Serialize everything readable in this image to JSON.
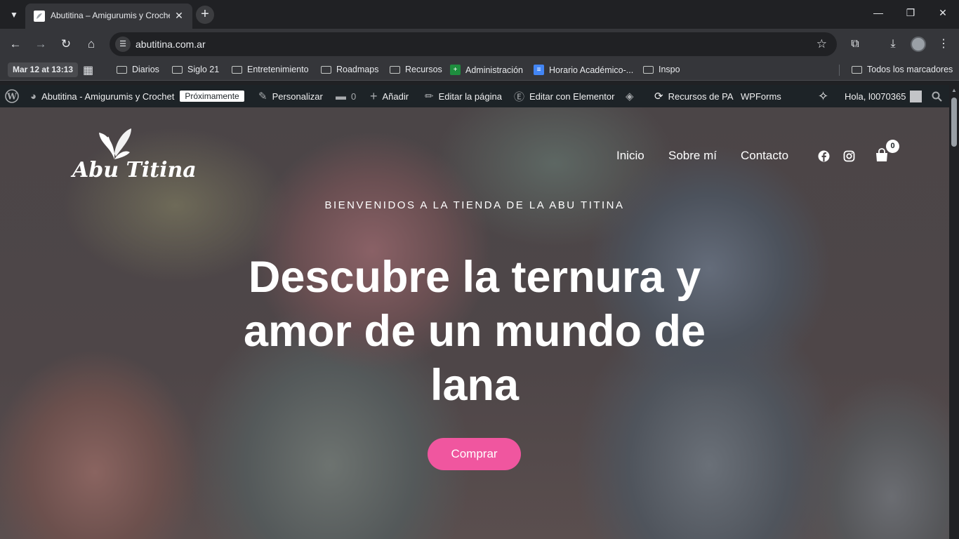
{
  "browser": {
    "tab": {
      "title": "Abutitina – Amigurumis y Crochet"
    },
    "address": {
      "url": "abutitina.com.ar"
    },
    "bookmarks": {
      "date_chip": "Mar 12 at 13:13",
      "items": [
        {
          "label": "Diarios",
          "type": "folder"
        },
        {
          "label": "Siglo 21",
          "type": "folder"
        },
        {
          "label": "Entretenimiento",
          "type": "folder"
        },
        {
          "label": "Roadmaps",
          "type": "folder"
        },
        {
          "label": "Recursos",
          "type": "folder"
        },
        {
          "label": "Administración",
          "type": "sheets"
        },
        {
          "label": "Horario Académico-...",
          "type": "docs"
        },
        {
          "label": "Inspo",
          "type": "folder"
        }
      ],
      "all_bookmarks": "Todos los marcadores"
    }
  },
  "adminbar": {
    "site_name": "Abutitina - Amigurumis y Crochet",
    "badge": "Próximamente",
    "customize": "Personalizar",
    "comments_count": "0",
    "add_new": "Añadir",
    "edit_page": "Editar la página",
    "edit_elementor": "Editar con Elementor",
    "resources": "Recursos de PA",
    "wpforms": "WPForms",
    "greeting": "Hola, l0070365"
  },
  "site": {
    "logo_text": "Abu Titina",
    "nav": [
      "Inicio",
      "Sobre mí",
      "Contacto"
    ],
    "cart_count": "0",
    "hero": {
      "kicker": "BIENVENIDOS A LA TIENDA DE LA ABU TITINA",
      "headline_line1": "Descubre la ternura y",
      "headline_line2": "amor de un mundo de",
      "headline_line3": "lana",
      "cta": "Comprar"
    },
    "colors": {
      "accent": "#f0569f",
      "adminbar": "#1d2327"
    }
  }
}
